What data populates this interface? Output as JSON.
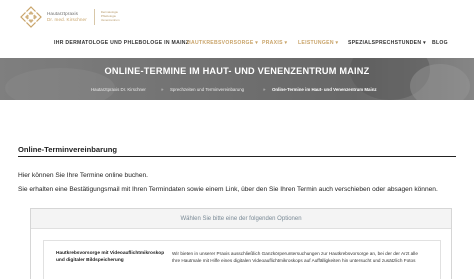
{
  "brand": {
    "name_line1": "Hautarztpraxis",
    "name_line2": "Dr. med. Kirschner",
    "tagline": [
      "Dermatologie",
      "Phlebologie",
      "Venenzentrum"
    ],
    "gold": "#c9a46a"
  },
  "nav": {
    "items": [
      {
        "label": "IHR DERMATOLOGE UND PHLEBOLOGE IN MAINZ",
        "accent": false
      },
      {
        "label": "HAUTKREBSVORSORGE ▾",
        "accent": true
      },
      {
        "label": "PRAXIS ▾",
        "accent": true
      },
      {
        "label": "LEISTUNGEN ▾",
        "accent": true
      },
      {
        "label": "SPEZIALSPRECHSTUNDEN ▾",
        "accent": false
      },
      {
        "label": "BLOG",
        "accent": false
      }
    ]
  },
  "hero": {
    "title": "ONLINE-TERMINE IM HAUT- UND VENENZENTRUM MAINZ",
    "breadcrumb": [
      "Hautarztpraxis Dr. Kirschner",
      "Sprechzeiten und Terminvereinbarung",
      "Online-Termine im Haut- und Venenzentrum Mainz"
    ],
    "separator": "»"
  },
  "main": {
    "section_title": "Online-Terminvereinbarung",
    "intro": "Hier können Sie Ihre Termine online buchen.",
    "info": "Sie erhalten eine Bestätigungsmail mit Ihren Termindaten sowie einem Link, über den Sie Ihren Termin auch verschieben oder absagen können."
  },
  "options": {
    "header": "Wählen Sie bitte eine der folgenden Optionen",
    "items": [
      {
        "name": "Hautkrebsvorsorge mit Videoauflichtmikroskop und digitaler Bildspeicherung",
        "description": "Wir bieten in unserer Praxis ausschließlich Ganzkörperuntersuchungen zur Hautkrebsvorsorge an, bei der der Arzt alle Ihre Hautmale mit Hilfe eines digitalen Videoauflichtmikroskops auf Auffälligkeiten hin untersucht und zusätzlich Fotos"
      }
    ]
  }
}
